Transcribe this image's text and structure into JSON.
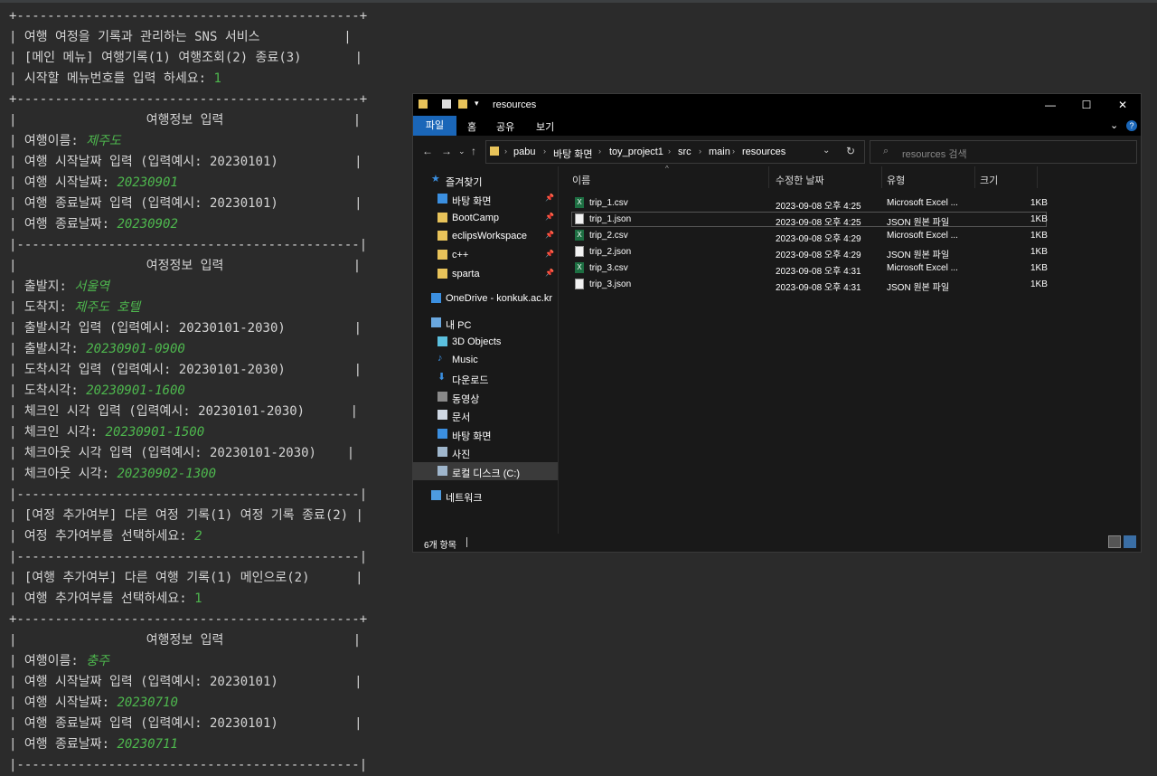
{
  "console": {
    "lines": [
      {
        "text": "+---------------------------------------------+"
      },
      {
        "text": "| 여행 여정을 기록과 관리하는 SNS 서비스           |"
      },
      {
        "text": "| [메인 메뉴] 여행기록(1) 여행조회(2) 종료(3)       |"
      },
      {
        "text": "| 시작할 메뉴번호를 입력 하세요: ",
        "input": "1"
      },
      {
        "text": "+---------------------------------------------+"
      },
      {
        "text": "|                 여행정보 입력                 |"
      },
      {
        "text": "| 여행이름: ",
        "input": "제주도",
        "italic": true
      },
      {
        "text": "| 여행 시작날짜 입력 (입력예시: 20230101)          |"
      },
      {
        "text": "| 여행 시작날짜: ",
        "input": "20230901",
        "italic": true
      },
      {
        "text": "| 여행 종료날짜 입력 (입력예시: 20230101)          |"
      },
      {
        "text": "| 여행 종료날짜: ",
        "input": "20230902",
        "italic": true
      },
      {
        "text": "|---------------------------------------------|"
      },
      {
        "text": "|                 여정정보 입력                 |"
      },
      {
        "text": "| 출발지: ",
        "input": "서울역",
        "italic": true
      },
      {
        "text": "| 도착지: ",
        "input": "제주도 호텔",
        "italic": true
      },
      {
        "text": "| 출발시각 입력 (입력예시: 20230101-2030)         |"
      },
      {
        "text": "| 출발시각: ",
        "input": "20230901-0900",
        "italic": true
      },
      {
        "text": "| 도착시각 입력 (입력예시: 20230101-2030)         |"
      },
      {
        "text": "| 도착시각: ",
        "input": "20230901-1600",
        "italic": true
      },
      {
        "text": "| 체크인 시각 입력 (입력예시: 20230101-2030)      |"
      },
      {
        "text": "| 체크인 시각: ",
        "input": "20230901-1500",
        "italic": true
      },
      {
        "text": "| 체크아웃 시각 입력 (입력예시: 20230101-2030)    |"
      },
      {
        "text": "| 체크아웃 시각: ",
        "input": "20230902-1300",
        "italic": true
      },
      {
        "text": "|---------------------------------------------|"
      },
      {
        "text": "| [여정 추가여부] 다른 여정 기록(1) 여정 기록 종료(2) |"
      },
      {
        "text": "| 여정 추가여부를 선택하세요: ",
        "input": "2",
        "italic": true
      },
      {
        "text": "|---------------------------------------------|"
      },
      {
        "text": "| [여행 추가여부] 다른 여행 기록(1) 메인으로(2)      |"
      },
      {
        "text": "| 여행 추가여부를 선택하세요: ",
        "input": "1"
      },
      {
        "text": "+---------------------------------------------+"
      },
      {
        "text": "|                 여행정보 입력                 |"
      },
      {
        "text": "| 여행이름: ",
        "input": "충주",
        "italic": true
      },
      {
        "text": "| 여행 시작날짜 입력 (입력예시: 20230101)          |"
      },
      {
        "text": "| 여행 시작날짜: ",
        "input": "20230710",
        "italic": true
      },
      {
        "text": "| 여행 종료날짜 입력 (입력예시: 20230101)          |"
      },
      {
        "text": "| 여행 종료날짜: ",
        "input": "20230711",
        "italic": true
      },
      {
        "text": "|---------------------------------------------|"
      }
    ]
  },
  "explorer": {
    "title": "resources",
    "ribbon_tabs": [
      "파일",
      "홈",
      "공유",
      "보기"
    ],
    "breadcrumbs": [
      "pabu",
      "바탕 화면",
      "toy_project1",
      "src",
      "main",
      "resources"
    ],
    "search_placeholder": "resources 검색",
    "columns": {
      "name": "이름",
      "modified": "수정한 날짜",
      "type": "유형",
      "size": "크기"
    },
    "nav": [
      {
        "label": "즐겨찾기",
        "icon": "star-icon"
      },
      {
        "label": "바탕 화면",
        "icon": "desktop-icon",
        "pinned": true
      },
      {
        "label": "BootCamp",
        "icon": "folder-icon",
        "pinned": true
      },
      {
        "label": "eclipsWorkspace",
        "icon": "folder-icon",
        "pinned": true
      },
      {
        "label": "c++",
        "icon": "folder-icon",
        "pinned": true
      },
      {
        "label": "sparta",
        "icon": "folder-icon",
        "pinned": true
      },
      {
        "label": "OneDrive - konkuk.ac.kr",
        "icon": "cloud-icon"
      },
      {
        "label": "내 PC",
        "icon": "pc-icon"
      },
      {
        "label": "3D Objects",
        "icon": "cube-icon"
      },
      {
        "label": "Music",
        "icon": "music-icon"
      },
      {
        "label": "다운로드",
        "icon": "download-icon"
      },
      {
        "label": "동영상",
        "icon": "video-icon"
      },
      {
        "label": "문서",
        "icon": "document-icon"
      },
      {
        "label": "바탕 화면",
        "icon": "desktop-icon"
      },
      {
        "label": "사진",
        "icon": "picture-icon"
      },
      {
        "label": "로컬 디스크 (C:)",
        "icon": "drive-icon",
        "selected": true
      },
      {
        "label": "네트워크",
        "icon": "network-icon"
      }
    ],
    "files": [
      {
        "name": "trip_1.csv",
        "modified": "2023-09-08 오후 4:25",
        "type": "Microsoft Excel ...",
        "size": "1KB",
        "icon": "excel-file-icon"
      },
      {
        "name": "trip_1.json",
        "modified": "2023-09-08 오후 4:25",
        "type": "JSON 원본 파일",
        "size": "1KB",
        "icon": "json-file-icon",
        "selected": true
      },
      {
        "name": "trip_2.csv",
        "modified": "2023-09-08 오후 4:29",
        "type": "Microsoft Excel ...",
        "size": "1KB",
        "icon": "excel-file-icon"
      },
      {
        "name": "trip_2.json",
        "modified": "2023-09-08 오후 4:29",
        "type": "JSON 원본 파일",
        "size": "1KB",
        "icon": "json-file-icon"
      },
      {
        "name": "trip_3.csv",
        "modified": "2023-09-08 오후 4:31",
        "type": "Microsoft Excel ...",
        "size": "1KB",
        "icon": "excel-file-icon"
      },
      {
        "name": "trip_3.json",
        "modified": "2023-09-08 오후 4:31",
        "type": "JSON 원본 파일",
        "size": "1KB",
        "icon": "json-file-icon"
      }
    ],
    "status": "6개 항목"
  }
}
